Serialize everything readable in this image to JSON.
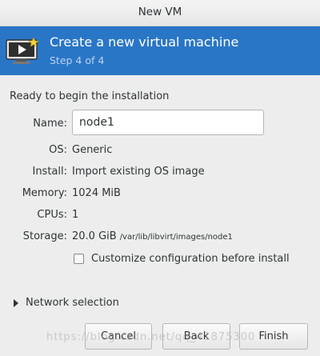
{
  "window": {
    "title": "New VM"
  },
  "banner": {
    "title": "Create a new virtual machine",
    "step": "Step 4 of 4",
    "icon": "monitor-play-icon"
  },
  "summary": {
    "heading": "Ready to begin the installation",
    "name_label": "Name:",
    "name_value": "node1",
    "os_label": "OS:",
    "os_value": "Generic",
    "install_label": "Install:",
    "install_value": "Import existing OS image",
    "memory_label": "Memory:",
    "memory_value": "1024 MiB",
    "cpus_label": "CPUs:",
    "cpus_value": "1",
    "storage_label": "Storage:",
    "storage_size": "20.0 GiB",
    "storage_path": "/var/lib/libvirt/images/node1"
  },
  "options": {
    "customize_label": "Customize configuration before install",
    "customize_checked": false,
    "network_label": "Network selection"
  },
  "buttons": {
    "cancel": "Cancel",
    "back": "Back",
    "finish": "Finish"
  },
  "watermark": "https://blog.csdn.net/qq_41875300",
  "colors": {
    "banner_bg": "#2a76c6",
    "window_bg": "#ededed"
  }
}
